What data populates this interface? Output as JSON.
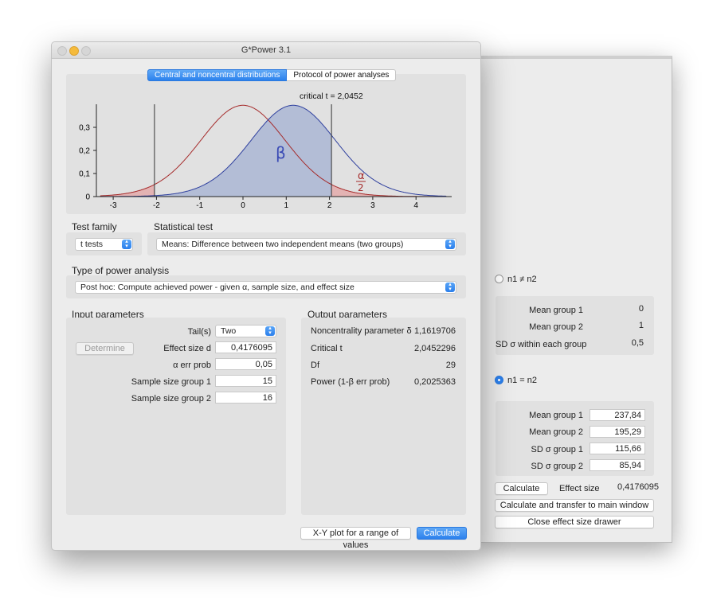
{
  "window_title": "G*Power 3.1",
  "tabs": [
    {
      "label": "Central and noncentral distributions",
      "active": true
    },
    {
      "label": "Protocol of power analyses",
      "active": false
    }
  ],
  "plot": {
    "critical_label": "critical t = 2,0452",
    "beta_label": "β",
    "alpha_num": "α",
    "alpha_den": "2",
    "y_ticks": [
      "0",
      "0,1",
      "0,2",
      "0,3"
    ],
    "x_ticks": [
      "-3",
      "-2",
      "-1",
      "0",
      "1",
      "2",
      "3",
      "4"
    ]
  },
  "test_family": {
    "label": "Test family",
    "value": "t tests"
  },
  "statistical_test": {
    "label": "Statistical test",
    "value": "Means: Difference between two independent means (two groups)"
  },
  "power_analysis": {
    "label": "Type of power analysis",
    "value": "Post hoc: Compute achieved power - given α, sample size, and effect size"
  },
  "input": {
    "title": "Input parameters",
    "determine_label": "Determine",
    "tails_label": "Tail(s)",
    "tails_value": "Two",
    "rows": [
      {
        "label": "Effect size d",
        "value": "0,4176095"
      },
      {
        "label": "α err prob",
        "value": "0,05"
      },
      {
        "label": "Sample size group 1",
        "value": "15"
      },
      {
        "label": "Sample size group 2",
        "value": "16"
      }
    ]
  },
  "output": {
    "title": "Output parameters",
    "rows": [
      {
        "label": "Noncentrality parameter δ",
        "value": "1,1619706"
      },
      {
        "label": "Critical t",
        "value": "2,0452296"
      },
      {
        "label": "Df",
        "value": "29"
      },
      {
        "label": "Power (1-β err prob)",
        "value": "0,2025363"
      }
    ]
  },
  "footer": {
    "xy_plot_label": "X-Y plot for a range of values",
    "calculate_label": "Calculate"
  },
  "drawer": {
    "radio1_label": "n1 ≠ n2",
    "radio1_rows": [
      {
        "label": "Mean group 1",
        "value": "0"
      },
      {
        "label": "Mean group 2",
        "value": "1"
      },
      {
        "label": "SD σ within each group",
        "value": "0,5"
      }
    ],
    "radio2_label": "n1 = n2",
    "radio2_rows": [
      {
        "label": "Mean group 1",
        "value": "237,84"
      },
      {
        "label": "Mean group 2",
        "value": "195,29"
      },
      {
        "label": "SD σ group 1",
        "value": "115,66"
      },
      {
        "label": "SD σ group 2",
        "value": "85,94"
      }
    ],
    "calculate_label": "Calculate",
    "effect_size_label": "Effect size",
    "effect_size_value": "0,4176095",
    "transfer_label": "Calculate and transfer to main window",
    "close_label": "Close effect size drawer"
  },
  "colors": {
    "accent": "#2c81ed",
    "central_curve": "#a52a2a",
    "noncentral_curve": "#2e3f9e",
    "beta_fill": "#b3bdd6",
    "alpha_fill": "#e3b3b3"
  }
}
